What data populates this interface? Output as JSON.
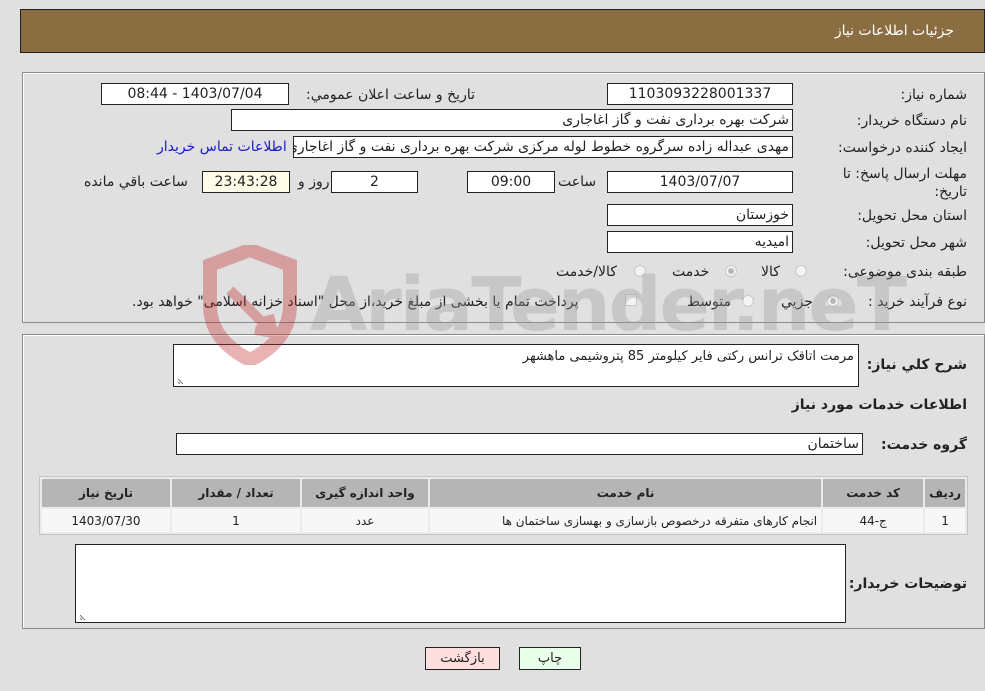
{
  "header": {
    "title": "جزئیات اطلاعات نیاز"
  },
  "form": {
    "need_number": {
      "label": "شماره نیاز:",
      "value": "1103093228001337"
    },
    "announce_datetime": {
      "label": "تاریخ و ساعت اعلان عمومي:",
      "value": "1403/07/04 - 08:44"
    },
    "buyer_org": {
      "label": "نام دستگاه خریدار:",
      "value": "شرکت بهره برداری نفت و گاز اغاجاری"
    },
    "requester": {
      "label": "ایجاد کننده درخواست:",
      "value": "مهدی عبداله زاده سرگروه خطوط لوله مرکزی شرکت بهره برداری نفت و گاز اغاجاری"
    },
    "buyer_contact_link": "اطلاعات تماس خریدار",
    "deadline": {
      "label": "مهلت ارسال پاسخ: تا تاریخ:",
      "date": "1403/07/07",
      "time_label": "ساعت",
      "time": "09:00",
      "days": "2",
      "days_label": "روز و",
      "remaining": "23:43:28",
      "remaining_label": "ساعت باقي مانده"
    },
    "province": {
      "label": "استان محل تحویل:",
      "value": "خوزستان"
    },
    "city": {
      "label": "شهر محل تحویل:",
      "value": "امیدیه"
    },
    "category": {
      "label": "طبقه بندی موضوعی:",
      "options": [
        "کالا",
        "خدمت",
        "کالا/خدمت"
      ],
      "selected": "خدمت"
    },
    "purchase_type": {
      "label": "نوع فرآیند خرید :",
      "options": [
        "جزيي",
        "متوسط"
      ],
      "selected": "جزيي",
      "treasury_note": "پرداخت تمام یا بخشی از مبلغ خرید،از محل \"اسناد خزانه اسلامی\" خواهد بود."
    }
  },
  "details": {
    "summary_label": "شرح کلي نیاز:",
    "summary_value": "مرمت اتاقک ترانس رکتی فایر کیلومتر 85 پتروشیمی ماهشهر",
    "services_heading": "اطلاعات خدمات مورد نیاز",
    "service_group_label": "گروه خدمت:",
    "service_group_value": "ساختمان",
    "table": {
      "headers": [
        "ردیف",
        "کد خدمت",
        "نام خدمت",
        "واحد اندازه گیری",
        "تعداد / مقدار",
        "تاریخ نیاز"
      ],
      "rows": [
        [
          "1",
          "ج-44",
          "انجام کارهای متفرقه درخصوص بازسازی و بهسازی ساختمان ها",
          "عدد",
          "1",
          "1403/07/30"
        ]
      ]
    },
    "buyer_notes_label": "توضیحات خریدار:",
    "buyer_notes_value": ""
  },
  "buttons": {
    "print": "چاپ",
    "back": "بازگشت"
  },
  "watermark": "AriaTender.neT",
  "colors": {
    "header_bg": "#8b6d42",
    "print_bg": "#eaffea",
    "back_bg": "#ffdede",
    "link": "#1a1ac8"
  }
}
